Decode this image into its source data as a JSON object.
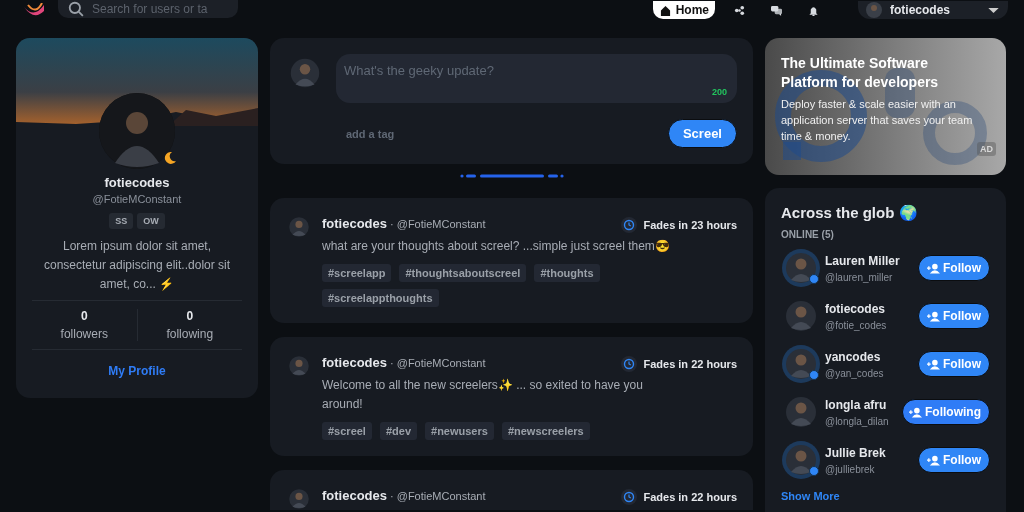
{
  "header": {
    "search": {
      "placeholder": "Search for users or ta"
    },
    "nav": [
      {
        "kind": "home",
        "label": "Home",
        "selected": true
      },
      {
        "kind": "explore",
        "selected": false
      },
      {
        "kind": "messages",
        "selected": false
      },
      {
        "kind": "notifications",
        "selected": false
      }
    ],
    "user_menu": {
      "username": "fotiecodes"
    }
  },
  "profile": {
    "name": "fotiecodes",
    "handle": "@FotieMConstant",
    "badges": [
      "SS",
      "OW"
    ],
    "bio": "Lorem ipsum dolor sit amet, consectetur adipiscing elit..dolor sit amet, co... ⚡",
    "stats": [
      {
        "value": "0",
        "label": "followers"
      },
      {
        "value": "0",
        "label": "following"
      }
    ],
    "link": "My Profile"
  },
  "composer": {
    "placeholder": "What's the geeky update?",
    "counter": "200",
    "tag_placeholder": "add a tag",
    "button": "Screel"
  },
  "feed": [
    {
      "author": "fotiecodes",
      "handle": "· @FotieMConstant",
      "fades": "Fades in 23 hours",
      "text": "what are your thoughts about screel? ...simple just screel them😎",
      "tags": [
        "#screelapp",
        "#thoughtsaboutscreel",
        "#thoughts",
        "#screelappthoughts"
      ]
    },
    {
      "author": "fotiecodes",
      "handle": "· @FotieMConstant",
      "fades": "Fades in 22 hours",
      "text": "Welcome to all the new screelers✨ ... so exited to have you around!",
      "tags": [
        "#screel",
        "#dev",
        "#newusers",
        "#newscreelers"
      ]
    },
    {
      "author": "fotiecodes",
      "handle": "· @FotieMConstant",
      "fades": "Fades in 22 hours"
    }
  ],
  "ad": {
    "title": "The Ultimate Software Platform for developers",
    "body": "Deploy faster & scale easier with an application server that saves your team time & money.",
    "badge": "AD"
  },
  "online": {
    "title": "Across the glob 🌍",
    "subtitle": "ONLINE (5)",
    "users": [
      {
        "name": "Lauren Miller",
        "handle": "@lauren_miller",
        "online": true,
        "following": false,
        "button": "Follow"
      },
      {
        "name": "fotiecodes",
        "handle": "@fotie_codes",
        "online": false,
        "following": false,
        "button": "Follow"
      },
      {
        "name": "yancodes",
        "handle": "@yan_codes",
        "online": true,
        "following": false,
        "button": "Follow"
      },
      {
        "name": "longla afru",
        "handle": "@longla_dilan",
        "online": false,
        "following": true,
        "button": "Following"
      },
      {
        "name": "Jullie Brek",
        "handle": "@julliebrek",
        "online": true,
        "following": false,
        "button": "Follow"
      }
    ],
    "show_more": "Show More"
  }
}
